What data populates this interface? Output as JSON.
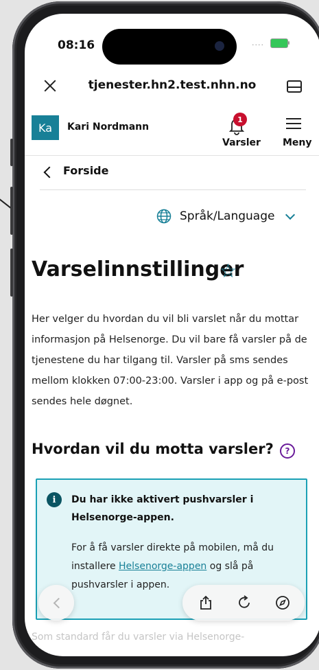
{
  "status_bar": {
    "time": "08:16",
    "signal": "....",
    "battery": "battery-charging-icon"
  },
  "browser": {
    "url": "tjenester.hn2.test.nhn.no"
  },
  "header": {
    "avatar_initials": "Ka",
    "user_name": "Kari Nordmann",
    "notifications_badge": "1",
    "notifications_label": "Varsler",
    "menu_label": "Meny"
  },
  "breadcrumb": {
    "back_label": "Forside"
  },
  "language": {
    "label": "Språk/Language"
  },
  "page": {
    "title": "Varselinnstillinger",
    "intro": "Her velger du hvordan du vil bli varslet når du mottar informasjon på Helsenorge. Du vil bare få varsler på de tjenestene du har tilgang til. Varsler på sms sendes mellom klokken 07:00-23:00. Varsler i app og på e-post sendes hele døgnet.",
    "section_title": "Hvordan vil du motta varsler?"
  },
  "notice": {
    "title": "Du har ikke aktivert pushvarsler i Helsenorge-appen.",
    "body_before": "For å få varsler direkte på mobilen, må du installere ",
    "link_text": "Helsenorge-appen",
    "body_after": " og slå på pushvarsler i appen."
  },
  "faded_text": "Som standard får du varsler via Helsenorge-",
  "colors": {
    "brand": "#188097",
    "badge": "#c8102e",
    "notice_bg": "#e2f5f7",
    "notice_border": "#1aa0b5"
  }
}
